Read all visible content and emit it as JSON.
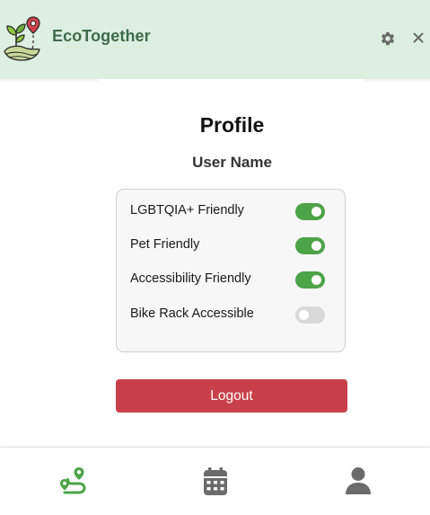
{
  "header": {
    "brand": "EcoTogether",
    "logo_icon": "eco-plant-location-logo",
    "settings_icon": "gear-icon",
    "close_icon": "close-icon"
  },
  "profile": {
    "title": "Profile",
    "user_name": "User Name",
    "preferences": [
      {
        "label": "LGBTQIA+ Friendly",
        "enabled": true
      },
      {
        "label": "Pet Friendly",
        "enabled": true
      },
      {
        "label": "Accessibility Friendly",
        "enabled": true
      },
      {
        "label": "Bike Rack Accessible",
        "enabled": false
      }
    ],
    "logout_label": "Logout"
  },
  "bottom_nav": [
    {
      "icon": "route-icon",
      "active": true
    },
    {
      "icon": "calendar-icon",
      "active": false
    },
    {
      "icon": "user-icon",
      "active": false
    }
  ],
  "colors": {
    "header_bg": "#dcefe0",
    "brand_text": "#3f6b4a",
    "toggle_on": "#4da347",
    "toggle_off": "#d9d9d9",
    "logout_bg": "#c84049",
    "nav_active": "#4da347",
    "nav_inactive": "#6b6b6b"
  }
}
